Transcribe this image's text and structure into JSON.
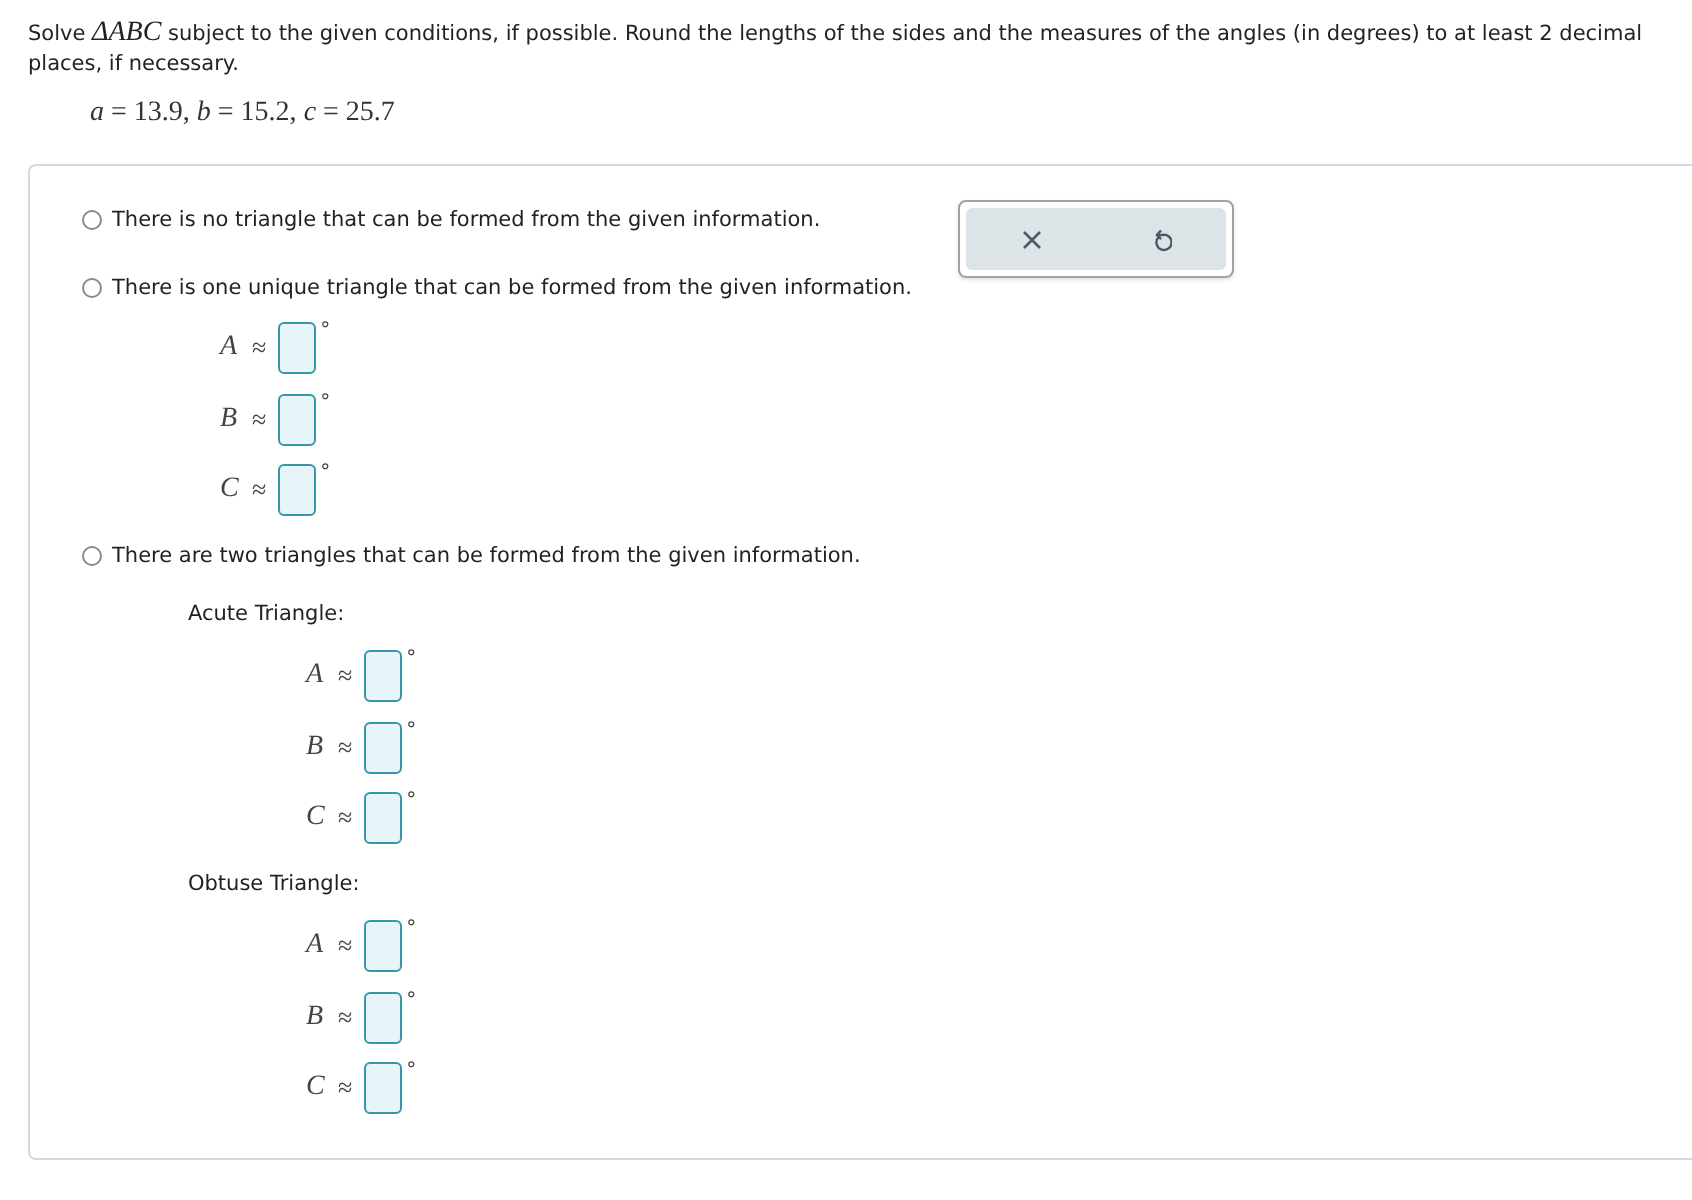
{
  "instructions": "Solve *ΔABC* subject to the given conditions, if possible. Round the lengths of the sides and the measures of the angles (in degrees) to at least 2 decimal places, if necessary.",
  "given": "*a* = 13.9, *b* = 15.2, *c* = 25.7",
  "options": [
    {
      "kind": "none",
      "label": "There is no triangle that can be formed from the given information.",
      "selected": false
    },
    {
      "kind": "one",
      "label": "There is one unique triangle that can be formed from the given information.",
      "selected": false,
      "answers": [
        {
          "symbol": "A",
          "relation": "≈",
          "unit": "°"
        },
        {
          "symbol": "B",
          "relation": "≈",
          "unit": "°"
        },
        {
          "symbol": "C",
          "relation": "≈",
          "unit": "°"
        }
      ]
    },
    {
      "kind": "two",
      "label": "There are two triangles that can be formed from the given information.",
      "selected": false,
      "groups": [
        {
          "title": "Acute Triangle:",
          "answers": [
            {
              "symbol": "A",
              "relation": "≈",
              "unit": "°"
            },
            {
              "symbol": "B",
              "relation": "≈",
              "unit": "°"
            },
            {
              "symbol": "C",
              "relation": "≈",
              "unit": "°"
            }
          ]
        },
        {
          "title": "Obtuse Triangle:",
          "answers": [
            {
              "symbol": "A",
              "relation": "≈",
              "unit": "°"
            },
            {
              "symbol": "B",
              "relation": "≈",
              "unit": "°"
            },
            {
              "symbol": "C",
              "relation": "≈",
              "unit": "°"
            }
          ]
        }
      ]
    }
  ]
}
